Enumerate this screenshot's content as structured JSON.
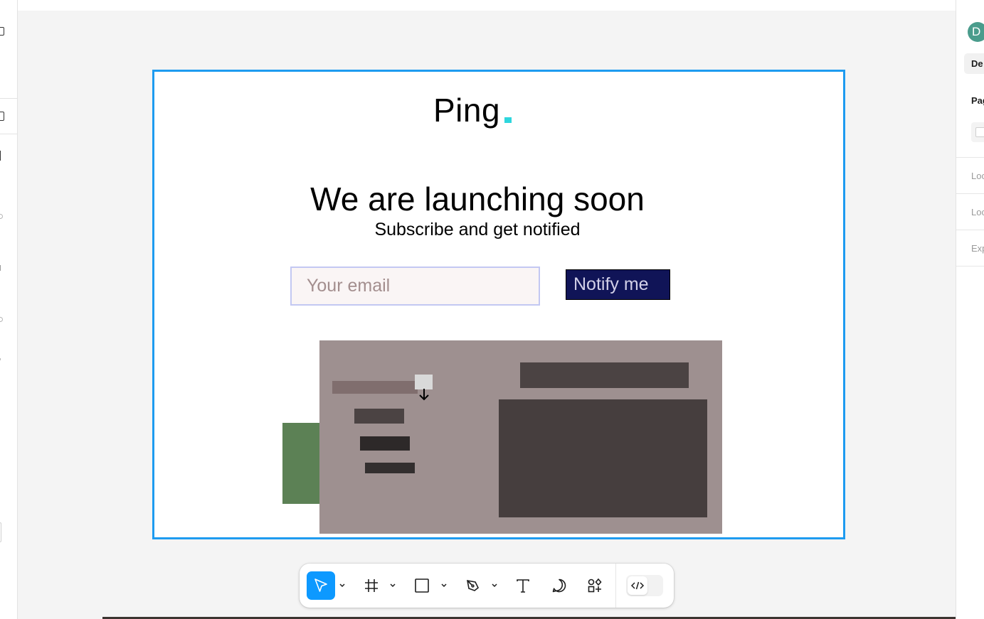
{
  "app": {
    "canvas_bg": "#f4f4f4",
    "selection_color": "#1e9bf0",
    "accent": "#0d99ff"
  },
  "right_panel": {
    "avatar_initial": "D",
    "design_tab": "De",
    "sections": [
      "Pag",
      "Loc",
      "Loc",
      "Exp"
    ]
  },
  "frame": {
    "logo": "Ping",
    "logo_dot_color": "#2ed6dd",
    "headline": "We are launching soon",
    "subheadline": "Subscribe and get notified",
    "email_placeholder": "Your email",
    "email_value": "",
    "notify_button": "Notify me",
    "button_color": "#101457"
  },
  "toolbar": {
    "tools": [
      {
        "name": "move",
        "icon": "cursor-arrow-icon",
        "active": true,
        "has_dropdown": true
      },
      {
        "name": "frame",
        "icon": "frame-hash-icon",
        "active": false,
        "has_dropdown": true
      },
      {
        "name": "rectangle",
        "icon": "rectangle-icon",
        "active": false,
        "has_dropdown": true
      },
      {
        "name": "pen",
        "icon": "pen-nib-icon",
        "active": false,
        "has_dropdown": true
      },
      {
        "name": "text",
        "icon": "text-t-icon",
        "active": false,
        "has_dropdown": false
      },
      {
        "name": "comment",
        "icon": "comment-bubble-icon",
        "active": false,
        "has_dropdown": false
      },
      {
        "name": "actions",
        "icon": "shapes-plus-icon",
        "active": false,
        "has_dropdown": false
      }
    ],
    "dev_mode_icon": "code-brackets-icon"
  }
}
